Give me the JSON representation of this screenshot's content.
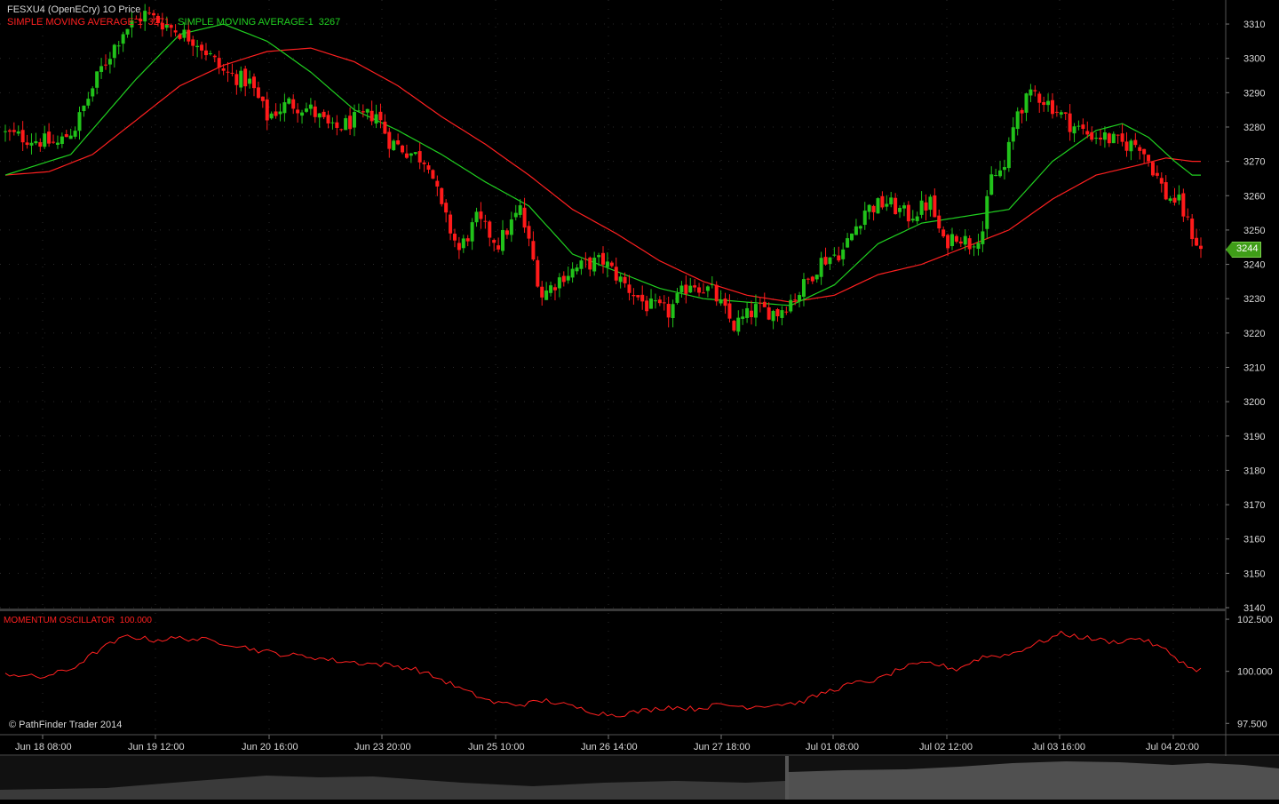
{
  "header": {
    "instrument": "FESXU4 (OpenECry) 1O Price",
    "series_label_1": "SIMPLE MOVING AVERAGE-1",
    "series_value_1": "3271",
    "series_label_2": "SIMPLE MOVING AVERAGE-1",
    "series_value_2": "3267"
  },
  "oscillator": {
    "label": "MOMENTUM OSCILLATOR",
    "value": "100.000"
  },
  "copyright": "© PathFinder Trader 2014",
  "current_price": "3244",
  "colors": {
    "background": "#000000",
    "up": "#21c21a",
    "down": "#ff1a1a",
    "sma_fast": "#20d020",
    "sma_slow": "#ff2020",
    "grid": "#2a2a2a",
    "axis_text": "#d8d8d8"
  },
  "chart_data": [
    {
      "type": "candlestick",
      "price_axis": {
        "ylim": [
          3140,
          3317
        ],
        "ticks": [
          "3310",
          "3300",
          "3290",
          "3280",
          "3270",
          "3260",
          "3250",
          "3240",
          "3230",
          "3220",
          "3210",
          "3200",
          "3190",
          "3180",
          "3170",
          "3160",
          "3150",
          "3140"
        ]
      },
      "x_axis": {
        "labels": [
          "Jun 18 08:00",
          "Jun 19 12:00",
          "Jun 20 16:00",
          "Jun 23 20:00",
          "Jun 25 10:00",
          "Jun 26 14:00",
          "Jun 27 18:00",
          "Jul 01 08:00",
          "Jul 02 12:00",
          "Jul 03 16:00",
          "Jul 04 20:00"
        ]
      },
      "close_anchors": [
        [
          0,
          3278
        ],
        [
          8,
          3276
        ],
        [
          12,
          3275
        ],
        [
          16,
          3280
        ],
        [
          22,
          3297
        ],
        [
          27,
          3308
        ],
        [
          32,
          3313
        ],
        [
          38,
          3309
        ],
        [
          44,
          3305
        ],
        [
          50,
          3296
        ],
        [
          56,
          3293
        ],
        [
          60,
          3283
        ],
        [
          65,
          3287
        ],
        [
          70,
          3285
        ],
        [
          75,
          3279
        ],
        [
          80,
          3282
        ],
        [
          85,
          3284
        ],
        [
          88,
          3276
        ],
        [
          92,
          3273
        ],
        [
          97,
          3270
        ],
        [
          100,
          3256
        ],
        [
          104,
          3244
        ],
        [
          108,
          3253
        ],
        [
          113,
          3246
        ],
        [
          118,
          3256
        ],
        [
          123,
          3231
        ],
        [
          128,
          3237
        ],
        [
          133,
          3240
        ],
        [
          137,
          3241
        ],
        [
          142,
          3234
        ],
        [
          147,
          3228
        ],
        [
          152,
          3226
        ],
        [
          157,
          3235
        ],
        [
          162,
          3232
        ],
        [
          167,
          3222
        ],
        [
          172,
          3227
        ],
        [
          177,
          3226
        ],
        [
          182,
          3232
        ],
        [
          187,
          3241
        ],
        [
          192,
          3244
        ],
        [
          197,
          3256
        ],
        [
          202,
          3258
        ],
        [
          207,
          3254
        ],
        [
          212,
          3258
        ],
        [
          215,
          3246
        ],
        [
          218,
          3249
        ],
        [
          221,
          3246
        ],
        [
          224,
          3250
        ],
        [
          226,
          3265
        ],
        [
          229,
          3268
        ],
        [
          232,
          3285
        ],
        [
          236,
          3290
        ],
        [
          240,
          3286
        ],
        [
          244,
          3281
        ],
        [
          248,
          3278
        ],
        [
          252,
          3277
        ],
        [
          256,
          3275
        ],
        [
          260,
          3275
        ],
        [
          263,
          3268
        ],
        [
          266,
          3260
        ],
        [
          269,
          3258
        ],
        [
          272,
          3249
        ],
        [
          274,
          3244
        ]
      ],
      "sma_fast_anchors": [
        [
          0,
          3266
        ],
        [
          15,
          3272
        ],
        [
          30,
          3294
        ],
        [
          40,
          3307
        ],
        [
          50,
          3310
        ],
        [
          60,
          3305
        ],
        [
          70,
          3296
        ],
        [
          80,
          3285
        ],
        [
          90,
          3279
        ],
        [
          100,
          3272
        ],
        [
          110,
          3264
        ],
        [
          120,
          3257
        ],
        [
          130,
          3243
        ],
        [
          140,
          3238
        ],
        [
          150,
          3233
        ],
        [
          160,
          3230
        ],
        [
          170,
          3229
        ],
        [
          180,
          3228
        ],
        [
          190,
          3234
        ],
        [
          200,
          3246
        ],
        [
          210,
          3252
        ],
        [
          220,
          3254
        ],
        [
          230,
          3256
        ],
        [
          240,
          3270
        ],
        [
          250,
          3279
        ],
        [
          256,
          3281
        ],
        [
          262,
          3277
        ],
        [
          268,
          3270
        ],
        [
          272,
          3266
        ]
      ],
      "sma_slow_anchors": [
        [
          0,
          3266
        ],
        [
          10,
          3267
        ],
        [
          20,
          3272
        ],
        [
          30,
          3282
        ],
        [
          40,
          3292
        ],
        [
          50,
          3298
        ],
        [
          60,
          3302
        ],
        [
          70,
          3303
        ],
        [
          80,
          3299
        ],
        [
          90,
          3292
        ],
        [
          100,
          3283
        ],
        [
          110,
          3275
        ],
        [
          120,
          3266
        ],
        [
          130,
          3256
        ],
        [
          140,
          3249
        ],
        [
          150,
          3241
        ],
        [
          160,
          3235
        ],
        [
          170,
          3231
        ],
        [
          180,
          3229
        ],
        [
          190,
          3231
        ],
        [
          200,
          3237
        ],
        [
          210,
          3240
        ],
        [
          220,
          3245
        ],
        [
          230,
          3250
        ],
        [
          240,
          3259
        ],
        [
          250,
          3266
        ],
        [
          260,
          3269
        ],
        [
          266,
          3271
        ],
        [
          272,
          3270
        ]
      ]
    },
    {
      "type": "line",
      "name": "MOMENTUM OSCILLATOR",
      "ylim": [
        97.0,
        102.8
      ],
      "ticks": [
        "102.500",
        "100.000",
        "97.500"
      ],
      "anchors": [
        [
          0,
          99.9
        ],
        [
          8,
          99.7
        ],
        [
          15,
          100.1
        ],
        [
          22,
          101.1
        ],
        [
          28,
          101.7
        ],
        [
          34,
          101.5
        ],
        [
          40,
          101.6
        ],
        [
          46,
          101.5
        ],
        [
          52,
          101.3
        ],
        [
          58,
          101.0
        ],
        [
          64,
          100.8
        ],
        [
          70,
          100.7
        ],
        [
          76,
          100.5
        ],
        [
          82,
          100.4
        ],
        [
          88,
          100.3
        ],
        [
          94,
          100.1
        ],
        [
          100,
          99.6
        ],
        [
          106,
          99.0
        ],
        [
          112,
          98.5
        ],
        [
          118,
          98.4
        ],
        [
          124,
          98.6
        ],
        [
          130,
          98.3
        ],
        [
          136,
          98.0
        ],
        [
          140,
          97.9
        ],
        [
          146,
          98.1
        ],
        [
          152,
          98.3
        ],
        [
          158,
          98.2
        ],
        [
          164,
          98.4
        ],
        [
          170,
          98.3
        ],
        [
          176,
          98.4
        ],
        [
          182,
          98.5
        ],
        [
          188,
          99.0
        ],
        [
          194,
          99.4
        ],
        [
          200,
          99.6
        ],
        [
          206,
          100.2
        ],
        [
          212,
          100.4
        ],
        [
          218,
          100.1
        ],
        [
          224,
          100.7
        ],
        [
          230,
          100.8
        ],
        [
          236,
          101.3
        ],
        [
          242,
          101.8
        ],
        [
          248,
          101.6
        ],
        [
          254,
          101.4
        ],
        [
          260,
          101.6
        ],
        [
          266,
          101.0
        ],
        [
          272,
          100.1
        ]
      ]
    }
  ]
}
